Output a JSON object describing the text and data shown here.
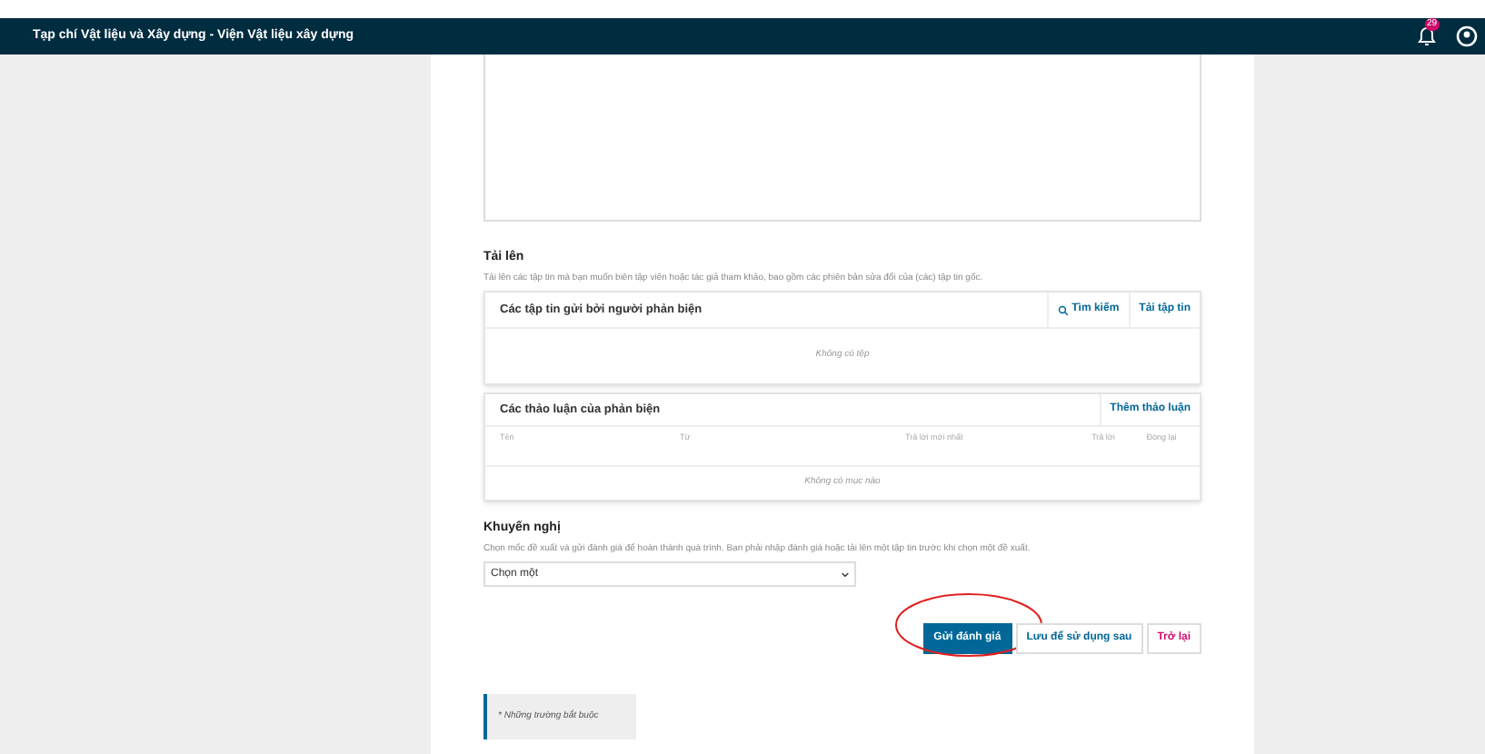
{
  "navbar": {
    "title": "Tạp chí Vật liệu và Xây dựng - Viện Vật liệu xây dựng",
    "notification_count": "29"
  },
  "upload": {
    "title": "Tải lên",
    "description": "Tải lên các tập tin mà bạn muốn biên tập viên hoặc tác giả tham khảo, bao gồm các phiên bản sửa đổi của (các) tập tin gốc.",
    "files_panel": {
      "title": "Các tập tin gửi bởi người phản biện",
      "buttons": [
        "Tìm kiếm",
        "Tải tập tin"
      ],
      "empty": "Không có tệp"
    }
  },
  "discussions": {
    "title": "Các thảo luận của phản biện",
    "add_button": "Thêm thảo luận",
    "columns": [
      "Tên",
      "Từ",
      "Trả lời mới nhất",
      "Trả lời",
      "Đóng lại"
    ],
    "empty": "Không có mục nào"
  },
  "recommendation": {
    "title": "Khuyến nghị",
    "description": "Chọn mốc đề xuất và gửi đánh giá để hoàn thành quá trình. Bạn phải nhập đánh giá hoặc tải lên một tập tin trước khi chọn một đề xuất.",
    "select_value": "Chọn một"
  },
  "actions": [
    {
      "label": "Gửi đánh giá",
      "kind": "primary",
      "circled": true
    },
    {
      "label": "Lưu để sử dụng sau",
      "kind": "secondary",
      "circled": false
    },
    {
      "label": "Trở lại",
      "kind": "cancel",
      "circled": false
    }
  ],
  "required_note": "* Những trường bắt buộc"
}
